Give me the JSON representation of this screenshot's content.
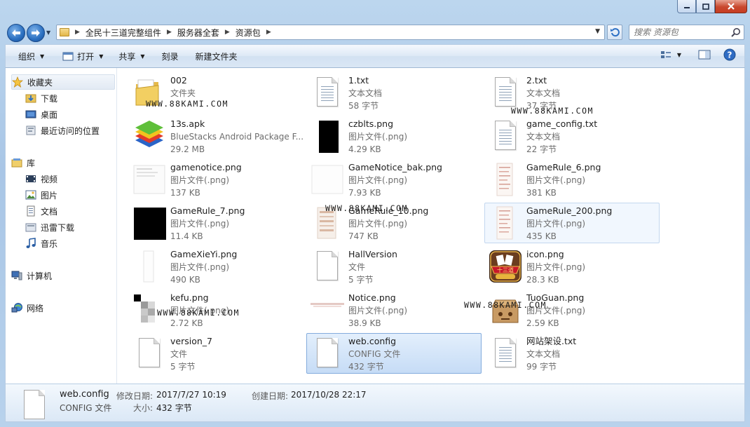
{
  "window": {
    "controls": [
      "minimize-icon",
      "maximize-icon",
      "close-icon"
    ]
  },
  "address": {
    "crumbs": [
      "全民十三道完整组件",
      "服务器全套",
      "资源包"
    ],
    "search_placeholder": "搜索 资源包"
  },
  "toolbar": {
    "organize": "组织",
    "open": "打开",
    "share": "共享",
    "burn": "刻录",
    "new_folder": "新建文件夹"
  },
  "sidebar": {
    "favorites": "收藏夹",
    "downloads": "下载",
    "desktop": "桌面",
    "recent": "最近访问的位置",
    "libraries": "库",
    "videos": "视频",
    "pictures": "图片",
    "documents": "文档",
    "thunder": "迅雷下载",
    "music": "音乐",
    "computer": "计算机",
    "network": "网络"
  },
  "files": [
    {
      "name": "002",
      "type": "文件夹",
      "size": "",
      "icon": "folder-icon"
    },
    {
      "name": "1.txt",
      "type": "文本文档",
      "size": "58 字节",
      "icon": "text-file-icon"
    },
    {
      "name": "2.txt",
      "type": "文本文档",
      "size": "37 字节",
      "icon": "text-file-icon"
    },
    {
      "name": "13s.apk",
      "type": "BlueStacks Android Package F...",
      "size": "29.2 MB",
      "icon": "bluestacks-icon"
    },
    {
      "name": "czblts.png",
      "type": "图片文件(.png)",
      "size": "4.29 KB",
      "icon": "image-thumbnail"
    },
    {
      "name": "game_config.txt",
      "type": "文本文档",
      "size": "22 字节",
      "icon": "text-file-icon"
    },
    {
      "name": "gamenotice.png",
      "type": "图片文件(.png)",
      "size": "137 KB",
      "icon": "image-thumbnail"
    },
    {
      "name": "GameNotice_bak.png",
      "type": "图片文件(.png)",
      "size": "7.93 KB",
      "icon": "image-thumbnail"
    },
    {
      "name": "GameRule_6.png",
      "type": "图片文件(.png)",
      "size": "381 KB",
      "icon": "image-thumbnail"
    },
    {
      "name": "GameRule_7.png",
      "type": "图片文件(.png)",
      "size": "11.4 KB",
      "icon": "image-thumbnail"
    },
    {
      "name": "GameRule_10.png",
      "type": "图片文件(.png)",
      "size": "747 KB",
      "icon": "image-thumbnail"
    },
    {
      "name": "GameRule_200.png",
      "type": "图片文件(.png)",
      "size": "435 KB",
      "icon": "image-thumbnail"
    },
    {
      "name": "GameXieYi.png",
      "type": "图片文件(.png)",
      "size": "490 KB",
      "icon": "image-thumbnail"
    },
    {
      "name": "HallVersion",
      "type": "文件",
      "size": "5 字节",
      "icon": "file-icon"
    },
    {
      "name": "icon.png",
      "type": "图片文件(.png)",
      "size": "28.3 KB",
      "icon": "image-thumbnail"
    },
    {
      "name": "kefu.png",
      "type": "图片文件(.png)",
      "size": "2.72 KB",
      "icon": "image-thumbnail"
    },
    {
      "name": "Notice.png",
      "type": "图片文件(.png)",
      "size": "38.9 KB",
      "icon": "image-thumbnail"
    },
    {
      "name": "TuoGuan.png",
      "type": "图片文件(.png)",
      "size": "2.59 KB",
      "icon": "image-thumbnail"
    },
    {
      "name": "version_7",
      "type": "文件",
      "size": "5 字节",
      "icon": "file-icon"
    },
    {
      "name": "web.config",
      "type": "CONFIG 文件",
      "size": "432 字节",
      "icon": "file-icon"
    },
    {
      "name": "网站架设.txt",
      "type": "文本文档",
      "size": "99 字节",
      "icon": "text-file-icon"
    }
  ],
  "watermark": "WWW.88KAMI.COM",
  "details": {
    "name": "web.config",
    "type": "CONFIG 文件",
    "modified_label": "修改日期:",
    "modified": "2017/7/27 10:19",
    "created_label": "创建日期:",
    "created": "2017/10/28 22:17",
    "size_label": "大小:",
    "size": "432 字节"
  }
}
